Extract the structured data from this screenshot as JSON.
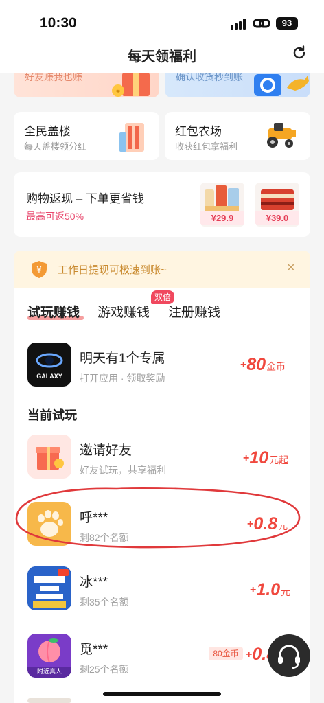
{
  "status": {
    "time": "10:30",
    "battery": "93"
  },
  "nav": {
    "title": "每天领福利"
  },
  "promos": {
    "left_text": "好友赚我也赚",
    "right_text": "确认收货秒到账"
  },
  "mini_cards": [
    {
      "title": "全民盖楼",
      "subtitle": "每天盖楼领分红"
    },
    {
      "title": "红包农场",
      "subtitle": "收获红包拿福利"
    }
  ],
  "shopping": {
    "title": "购物返现 – 下单更省钱",
    "subtitle": "最高可返50%",
    "products": [
      {
        "price": "¥29.9"
      },
      {
        "price": "¥39.0"
      }
    ]
  },
  "notice": {
    "text": "工作日提现可极速到账~",
    "close": "×"
  },
  "tabs": [
    {
      "label": "试玩赚钱",
      "active": true
    },
    {
      "label": "游戏赚钱",
      "active": false,
      "badge": "双倍"
    },
    {
      "label": "注册赚钱",
      "active": false
    }
  ],
  "featured": {
    "name": "明天有1个专属",
    "subtitle": "打开应用 · 领取奖励",
    "reward_plus": "+",
    "reward_value": "80",
    "reward_unit": "金币",
    "icon": "galaxy-app-icon",
    "icon_text": "GALAXY"
  },
  "section_title": "当前试玩",
  "items": [
    {
      "name": "邀请好友",
      "subtitle": "好友试玩，共享福利",
      "reward_plus": "+",
      "reward_value": "10",
      "reward_unit": "元起",
      "icon": "gift-icon"
    },
    {
      "name": "呼***",
      "subtitle": "剩82个名额",
      "reward_plus": "+",
      "reward_value": "0.8",
      "reward_unit": "元",
      "icon": "paw-icon"
    },
    {
      "name": "冰***",
      "subtitle": "剩35个名额",
      "reward_plus": "+",
      "reward_value": "1.0",
      "reward_unit": "元",
      "icon": "dragon-game-icon"
    },
    {
      "name": "觅***",
      "subtitle": "剩25个名额",
      "reward_plus": "+",
      "reward_value": "0.8",
      "reward_unit": "",
      "coin_chip": "80金币",
      "icon": "peach-icon",
      "icon_caption": "附近真人"
    }
  ],
  "colors": {
    "accent": "#f0483e",
    "annotation": "#e0393b",
    "badge": "#f0485e"
  }
}
